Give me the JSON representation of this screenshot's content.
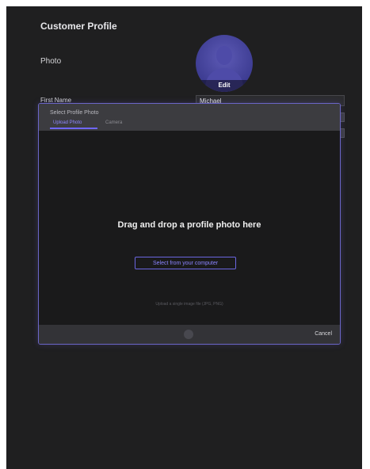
{
  "page": {
    "title": "Customer Profile",
    "photo_label": "Photo",
    "avatar_action": "Edit"
  },
  "form": {
    "first_name_label": "First Name",
    "first_name_value": "Michael"
  },
  "modal": {
    "title": "Select Profile Photo",
    "tabs": [
      {
        "label": "Upload Photo"
      },
      {
        "label": "Camera"
      }
    ],
    "drop_text": "Drag and drop a profile photo here",
    "select_button": "Select from your computer",
    "hint": "Upload a single image file (JPG, PNG)",
    "cancel_label": "Cancel"
  },
  "icons": {
    "avatar": "avatar-icon",
    "spinner": "loading-icon"
  },
  "colors": {
    "accent": "#6f67ff",
    "modal_border": "#6b66c8",
    "background": "#1f1f20"
  }
}
